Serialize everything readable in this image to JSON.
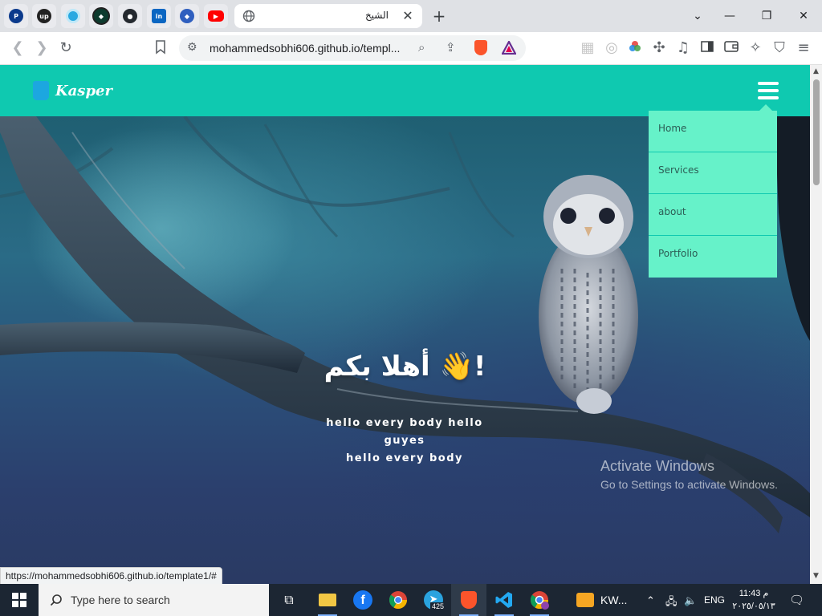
{
  "browser": {
    "active_tab": {
      "title": "الشيخ"
    },
    "address_bar": {
      "url": "mohammedsobhi606.github.io/templ..."
    },
    "status_url": "https://mohammedsobhi606.github.io/template1/#"
  },
  "site": {
    "logo_text": "Kasper",
    "menu": [
      "Home",
      "Services",
      "about",
      "Portfolio"
    ],
    "hero": {
      "title": "أهلا بكم 👋!",
      "subtitle_line1": "hello every body hello guyes",
      "subtitle_line2": "hello every body"
    },
    "accent_color": "#0fc9b0",
    "menu_color": "#66f2c9"
  },
  "os": {
    "watermark_title": "Activate Windows",
    "watermark_sub": "Go to Settings to activate Windows.",
    "search_placeholder": "Type here to search",
    "telegram_badge": "425",
    "kw_label": "KW...",
    "language": "ENG",
    "time": "11:43 م",
    "date": "٢٠٢٥/٠٥/١٣"
  }
}
